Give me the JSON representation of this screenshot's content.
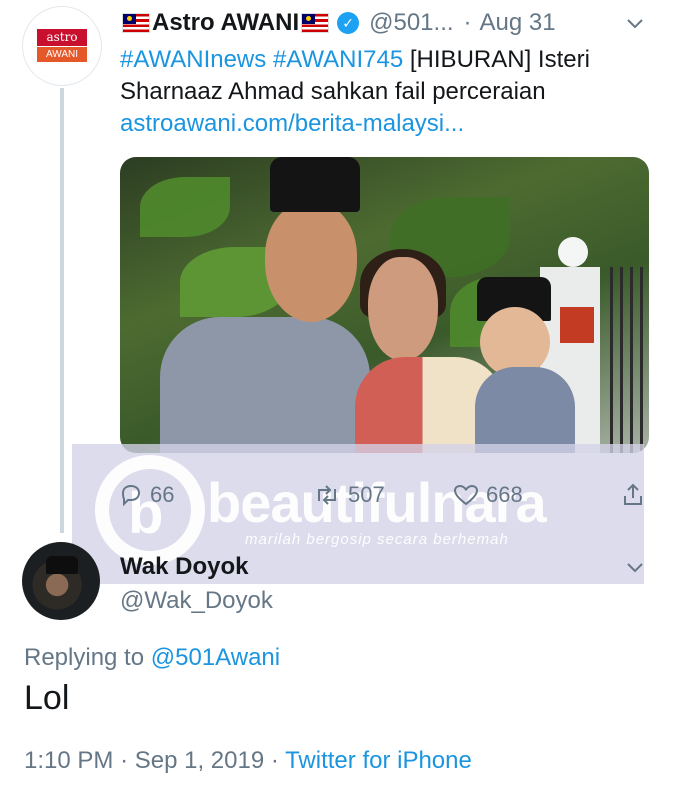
{
  "original_tweet": {
    "avatar": {
      "top_text": "astro",
      "bottom_text": "AWANI",
      "brand_red": "#c8102e",
      "brand_orange": "#e4582a"
    },
    "display_name": "Astro AWANI",
    "flag_icon": "malaysia-flag-icon",
    "verified_icon": "verified-badge-icon",
    "handle": "@501...",
    "separator": "·",
    "date": "Aug 31",
    "text": {
      "hashtag1": "#AWANInews",
      "hashtag2": "#AWANI745",
      "body": " [HIBURAN] Isteri Sharnaaz Ahmad sahkan fail perceraian"
    },
    "link": "astroawani.com/berita-malaysi...",
    "actions": {
      "reply_count": "66",
      "retweet_count": "507",
      "like_count": "668"
    }
  },
  "watermark": {
    "logo_text": "beautifulnara",
    "logo_letter": "b",
    "tagline": "marilah bergosip secara berhemah"
  },
  "reply_tweet": {
    "display_name": "Wak Doyok",
    "handle": "@Wak_Doyok",
    "replying_prefix": "Replying to ",
    "replying_mention": "@501Awani",
    "text": "Lol",
    "time": "1:10 PM",
    "date": "Sep 1, 2019",
    "separator": "·",
    "source": "Twitter for iPhone"
  },
  "colors": {
    "link_blue": "#1b95e0",
    "muted_gray": "#657786",
    "text_dark": "#14171a",
    "verified_blue": "#1da1f2"
  }
}
